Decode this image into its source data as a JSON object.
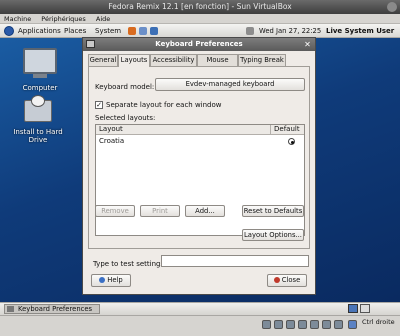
{
  "vbox": {
    "title": "Fedora Remix 12.1 [en fonction] - Sun VirtualBox",
    "menu": [
      "Machine",
      "Périphériques",
      "Aide"
    ],
    "host_key": "Ctrl droite"
  },
  "panel": {
    "menus": [
      "Applications",
      "Places",
      "System"
    ],
    "clock": "Wed Jan 27, 22:25",
    "user": "Live System User"
  },
  "desktop_icons": [
    "Computer",
    "Install to Hard Drive"
  ],
  "dialog": {
    "title": "Keyboard Preferences",
    "tabs": [
      "General",
      "Layouts",
      "Accessibility",
      "Mouse Keys",
      "Typing Break"
    ],
    "active_tab": "Layouts",
    "keyboard_model_label": "Keyboard model:",
    "keyboard_model_value": "Evdev-managed keyboard",
    "separate_layout_label": "Separate layout for each window",
    "separate_layout_checked": true,
    "selected_layouts_label": "Selected layouts:",
    "table": {
      "columns": [
        "Layout",
        "Default"
      ],
      "rows": [
        {
          "layout": "Croatia",
          "default": true
        }
      ]
    },
    "buttons": {
      "remove": "Remove",
      "print": "Print",
      "add": "Add...",
      "reset": "Reset to Defaults",
      "options": "Layout Options...",
      "help": "Help",
      "close": "Close"
    },
    "test_label": "Type to test settings:",
    "test_value": ""
  },
  "taskbar": {
    "window_button": "Keyboard Preferences"
  }
}
